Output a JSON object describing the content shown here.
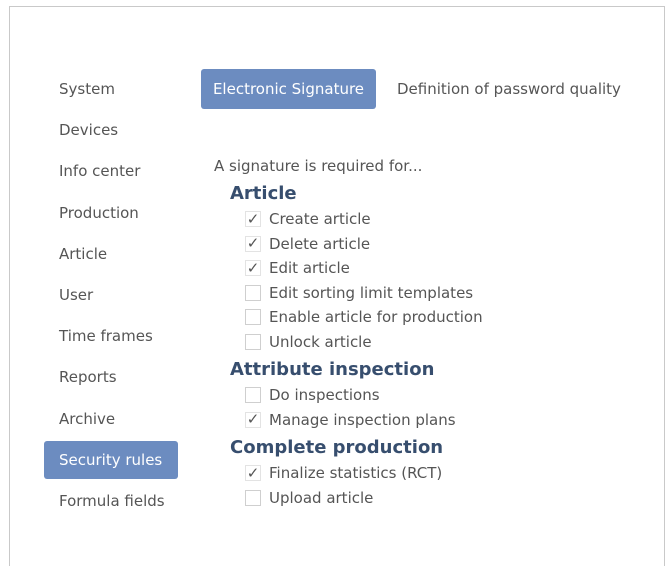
{
  "sidebar": {
    "items": [
      {
        "label": "System",
        "active": false
      },
      {
        "label": "Devices",
        "active": false
      },
      {
        "label": "Info center",
        "active": false
      },
      {
        "label": "Production",
        "active": false
      },
      {
        "label": "Article",
        "active": false
      },
      {
        "label": "User",
        "active": false
      },
      {
        "label": "Time frames",
        "active": false
      },
      {
        "label": "Reports",
        "active": false
      },
      {
        "label": "Archive",
        "active": false
      },
      {
        "label": "Security rules",
        "active": true
      },
      {
        "label": "Formula fields",
        "active": false
      }
    ]
  },
  "tabs": [
    {
      "label": "Electronic Signature",
      "active": true
    },
    {
      "label": "Definition of password quality",
      "active": false
    }
  ],
  "content": {
    "intro": "A signature is required for...",
    "groups": [
      {
        "title": "Article",
        "items": [
          {
            "label": "Create article",
            "checked": true
          },
          {
            "label": "Delete article",
            "checked": true
          },
          {
            "label": "Edit article",
            "checked": true
          },
          {
            "label": "Edit sorting limit templates",
            "checked": false
          },
          {
            "label": "Enable article for production",
            "checked": false
          },
          {
            "label": "Unlock article",
            "checked": false
          }
        ]
      },
      {
        "title": "Attribute inspection",
        "items": [
          {
            "label": "Do inspections",
            "checked": false
          },
          {
            "label": "Manage inspection plans",
            "checked": true
          }
        ]
      },
      {
        "title": "Complete production",
        "items": [
          {
            "label": "Finalize statistics (RCT)",
            "checked": true
          },
          {
            "label": "Upload article",
            "checked": false
          }
        ]
      }
    ]
  },
  "colors": {
    "accent": "#6c8cc0",
    "group_title": "#374e6e",
    "text": "#555555"
  },
  "icons": {
    "checkmark": "check-icon"
  }
}
